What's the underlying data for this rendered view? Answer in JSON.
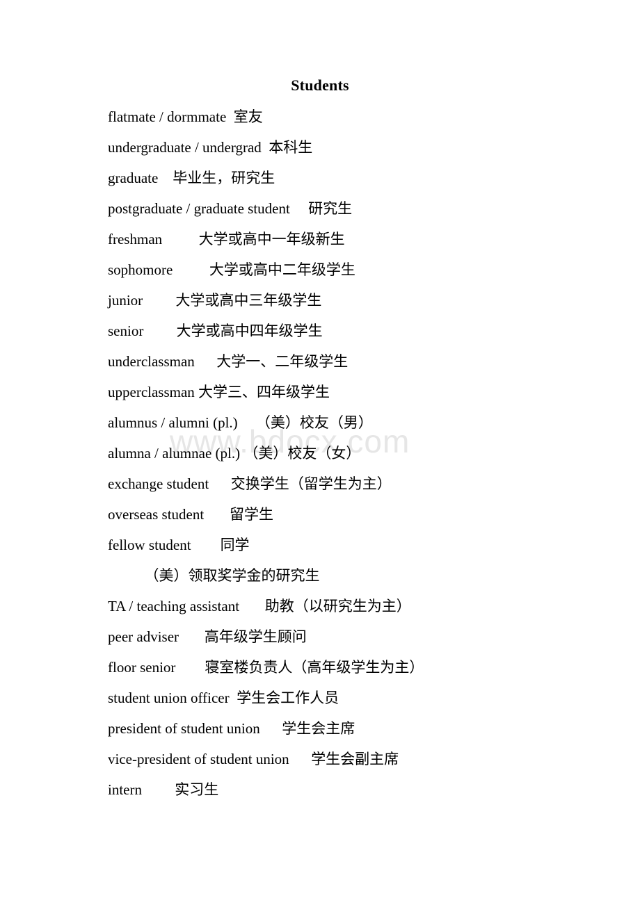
{
  "document": {
    "title": "Students",
    "background_color": "#ffffff",
    "text_color": "#000000"
  },
  "watermark": {
    "text": "www.bdocx.com",
    "color": "#e6e6e6"
  },
  "entries": [
    {
      "term": "flatmate / dormmate",
      "gap": "  ",
      "gloss": "室友"
    },
    {
      "term": "undergraduate / undergrad",
      "gap": "  ",
      "gloss": "本科生"
    },
    {
      "term": "graduate",
      "gap": "    ",
      "gloss": "毕业生，研究生"
    },
    {
      "term": "postgraduate / graduate student",
      "gap": "     ",
      "gloss": "研究生"
    },
    {
      "term": "freshman",
      "gap": "          ",
      "gloss": "大学或高中一年级新生"
    },
    {
      "term": "sophomore",
      "gap": "          ",
      "gloss": "大学或高中二年级学生"
    },
    {
      "term": "junior",
      "gap": "         ",
      "gloss": "大学或高中三年级学生"
    },
    {
      "term": "senior",
      "gap": "         ",
      "gloss": "大学或高中四年级学生"
    },
    {
      "term": "underclassman",
      "gap": "      ",
      "gloss": "大学一、二年级学生"
    },
    {
      "term": "upperclassman",
      "gap": " ",
      "gloss": "大学三、四年级学生"
    },
    {
      "term": "alumnus / alumni (pl.)",
      "gap": "     ",
      "gloss": "（美）校友（男）"
    },
    {
      "term": "alumna / alumnae (pl.)",
      "gap": " ",
      "gloss": "（美）校友（女）"
    },
    {
      "term": "exchange student",
      "gap": "      ",
      "gloss": "交换学生（留学生为主）"
    },
    {
      "term": "overseas student",
      "gap": "       ",
      "gloss": "留学生"
    },
    {
      "term": "fellow student",
      "gap": "        ",
      "gloss": "同学"
    },
    {
      "term": "",
      "gap": "          ",
      "gloss": "（美）领取奖学金的研究生"
    },
    {
      "term": "TA / teaching assistant",
      "gap": "       ",
      "gloss": "助教（以研究生为主）"
    },
    {
      "term": "peer adviser",
      "gap": "       ",
      "gloss": "高年级学生顾问"
    },
    {
      "term": "floor senior",
      "gap": "        ",
      "gloss": "寝室楼负责人（高年级学生为主）"
    },
    {
      "term": "student union officer",
      "gap": "  ",
      "gloss": "学生会工作人员"
    },
    {
      "term": "president of student union",
      "gap": "      ",
      "gloss": "学生会主席"
    },
    {
      "term": "vice-president of student union",
      "gap": "      ",
      "gloss": "学生会副主席"
    },
    {
      "term": "intern",
      "gap": "         ",
      "gloss": "实习生"
    }
  ]
}
